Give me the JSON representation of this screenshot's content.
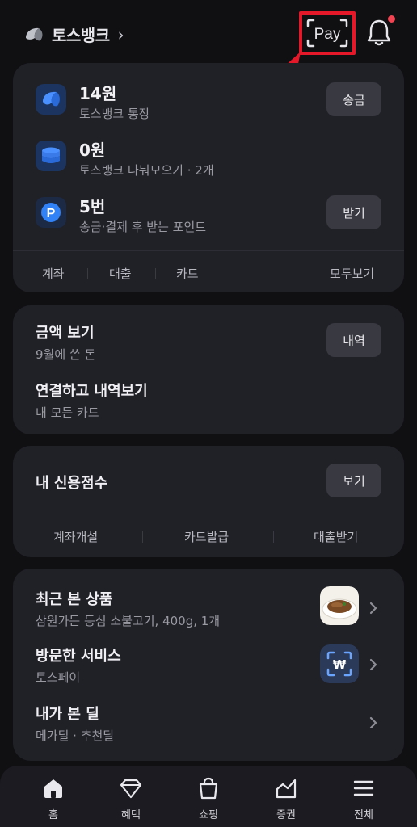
{
  "header": {
    "brand": "토스뱅크",
    "pay_label": "Pay"
  },
  "accounts": [
    {
      "title": "14원",
      "subtitle": "토스뱅크 통장",
      "button": "송금",
      "icon": "toss-bank-icon"
    },
    {
      "title": "0원",
      "subtitle": "토스뱅크 나눠모으기 · 2개",
      "icon": "stack-coins-icon"
    },
    {
      "title": "5번",
      "subtitle": "송금·결제 후 받는 포인트",
      "button": "받기",
      "icon": "points-icon"
    }
  ],
  "account_tabs": [
    "계좌",
    "대출",
    "카드"
  ],
  "view_all": "모두보기",
  "spending": {
    "title": "금액 보기",
    "subtitle": "9월에 쓴 돈",
    "button": "내역",
    "link_title": "연결하고 내역보기",
    "link_subtitle": "내 모든 카드"
  },
  "credit": {
    "title": "내 신용점수",
    "button": "보기",
    "actions": [
      "계좌개설",
      "카드발급",
      "대출받기"
    ]
  },
  "recent": [
    {
      "title": "최근 본 상품",
      "subtitle": "삼원가든 등심 소불고기, 400g, 1개",
      "thumb": "food-thumbnail"
    },
    {
      "title": "방문한 서비스",
      "subtitle": "토스페이",
      "thumb": "toss-pay-thumbnail"
    },
    {
      "title": "내가 본 딜",
      "subtitle": "메가딜 · 추천딜"
    }
  ],
  "nav": [
    {
      "label": "홈",
      "icon": "home-icon"
    },
    {
      "label": "혜택",
      "icon": "diamond-icon"
    },
    {
      "label": "쇼핑",
      "icon": "shopping-bag-icon"
    },
    {
      "label": "증권",
      "icon": "chart-icon"
    },
    {
      "label": "전체",
      "icon": "menu-icon"
    }
  ],
  "colors": {
    "background": "#101013",
    "card": "#202027",
    "pill": "#393941",
    "highlight": "#e5182a",
    "notification_dot": "#f04452",
    "toss_blue": "#3182f6"
  }
}
